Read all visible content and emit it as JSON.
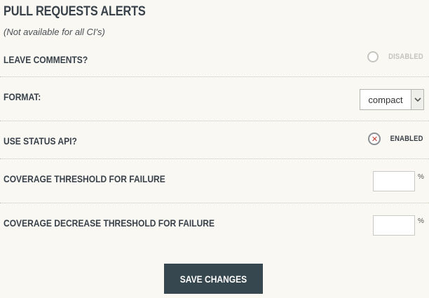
{
  "section": {
    "title": "PULL REQUESTS ALERTS",
    "subtitle": "(Not available for all CI's)"
  },
  "leave_comments": {
    "label": "LEAVE COMMENTS?",
    "state": "DISABLED",
    "enabled": false
  },
  "format": {
    "label": "FORMAT:",
    "selected": "compact"
  },
  "status_api": {
    "label": "USE STATUS API?",
    "state": "ENABLED",
    "enabled": true,
    "icon": "x-mark"
  },
  "coverage_threshold": {
    "label": "COVERAGE THRESHOLD FOR FAILURE",
    "value": "",
    "unit": "%"
  },
  "coverage_decrease_threshold": {
    "label": "COVERAGE DECREASE THRESHOLD FOR FAILURE",
    "value": "",
    "unit": "%"
  },
  "actions": {
    "save_label": "SAVE CHANGES"
  },
  "colors": {
    "background": "#f9f8f3",
    "button": "#36474f",
    "x_mark": "#c0392b"
  }
}
